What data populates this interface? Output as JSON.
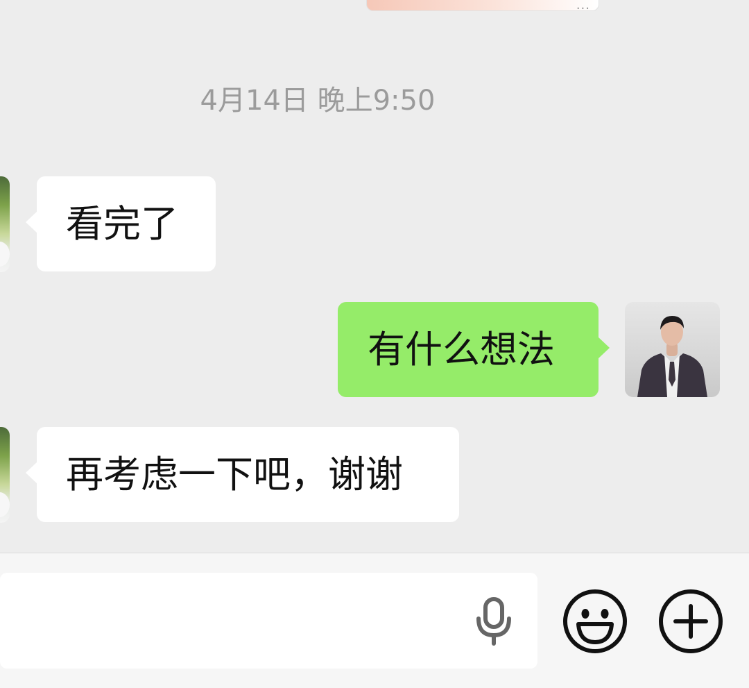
{
  "chat": {
    "timestamp": "4月14日 晚上9:50",
    "messages": [
      {
        "side": "left",
        "text": "看完了"
      },
      {
        "side": "right",
        "text": "有什么想法"
      },
      {
        "side": "left",
        "text": "再考虑一下吧，谢谢"
      }
    ],
    "previous_card_more": "..."
  },
  "input_bar": {
    "message_placeholder": "",
    "icons": {
      "voice": "microphone-icon",
      "emoji": "smiley-face-icon",
      "more": "plus-circle-icon"
    }
  },
  "colors": {
    "chat_background": "#ededed",
    "sent_bubble": "#95ec69",
    "received_bubble": "#ffffff",
    "timestamp_text": "#9b9b9b",
    "input_bar_background": "#f6f6f6"
  }
}
